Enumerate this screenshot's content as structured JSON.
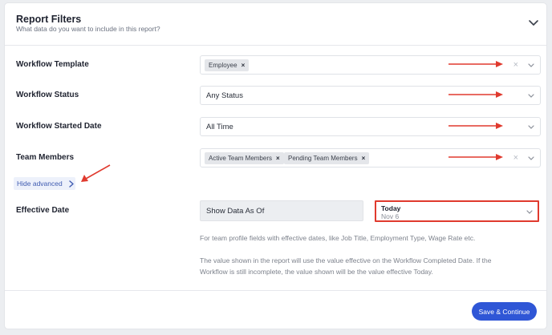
{
  "header": {
    "title": "Report Filters",
    "subtitle": "What data do you want to include in this report?"
  },
  "fields": {
    "workflow_template": {
      "label": "Workflow Template",
      "tags": [
        "Employee"
      ]
    },
    "workflow_status": {
      "label": "Workflow Status",
      "value": "Any Status"
    },
    "workflow_started_date": {
      "label": "Workflow Started Date",
      "value": "All Time"
    },
    "team_members": {
      "label": "Team Members",
      "tags": [
        "Active Team Members",
        "Pending Team Members"
      ]
    }
  },
  "advanced": {
    "toggle_label": "Hide advanced"
  },
  "effective_date": {
    "label": "Effective Date",
    "mode": "Show Data As Of",
    "date_main": "Today",
    "date_sub": "Nov 6",
    "help_1": "For team profile fields with effective dates, like Job Title, Employment Type, Wage Rate etc.",
    "help_2_line1": "The value shown in the report will use the value effective on the Workflow Completed Date. If the",
    "help_2_line2": "Workflow is still incomplete, the value shown will be the value effective Today."
  },
  "footer": {
    "save_label": "Save & Continue"
  },
  "icons": {
    "tag_remove": "×",
    "clear": "×",
    "chevron": "chevron-down-icon",
    "chevron_right": "chevron-right-icon"
  },
  "colors": {
    "accent": "#2f56d6",
    "annotation_red": "#e03a2e",
    "link": "#3f5bb0"
  }
}
